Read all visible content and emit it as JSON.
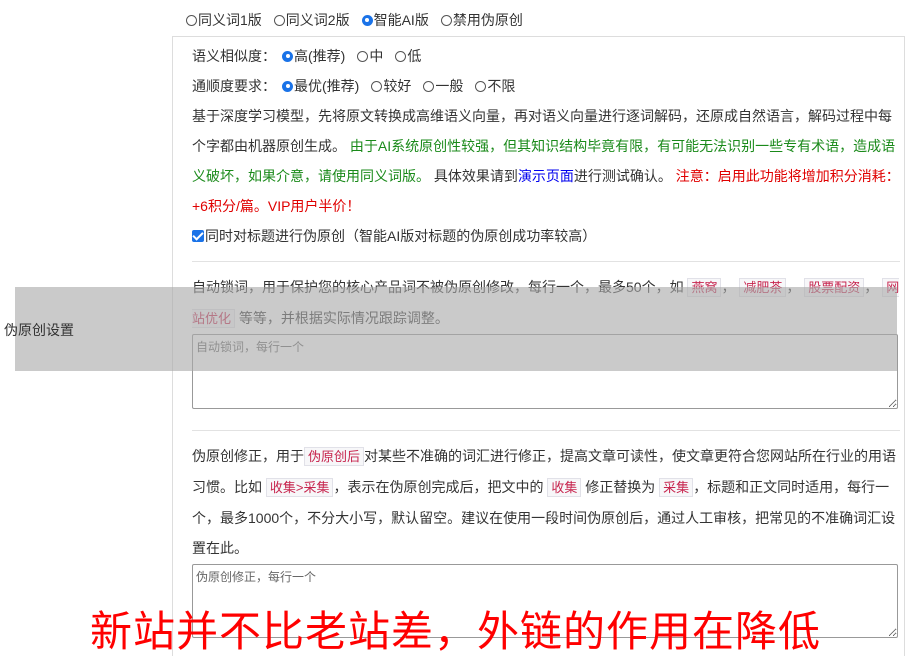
{
  "mode_options": [
    {
      "label": "同义词1版",
      "selected": false
    },
    {
      "label": "同义词2版",
      "selected": false
    },
    {
      "label": "智能AI版",
      "selected": true
    },
    {
      "label": "禁用伪原创",
      "selected": false
    }
  ],
  "similarity": {
    "label": "语义相似度：",
    "options": [
      {
        "label": "高(推荐)",
        "selected": true
      },
      {
        "label": "中",
        "selected": false
      },
      {
        "label": "低",
        "selected": false
      }
    ]
  },
  "fluency": {
    "label": "通顺度要求：",
    "options": [
      {
        "label": "最优(推荐)",
        "selected": true
      },
      {
        "label": "较好",
        "selected": false
      },
      {
        "label": "一般",
        "selected": false
      },
      {
        "label": "不限",
        "selected": false
      }
    ]
  },
  "description": {
    "text1": "基于深度学习模型，先将原文转换成高维语义向量，再对语义向量进行逐词解码，还原成自然语言，解码过程中每个字都由机器原创生成。",
    "warning_green": "由于AI系统原创性较强，但其知识结构毕竟有限，有可能无法识别一些专有术语，造成语义破坏，如果介意，请使用同义词版。",
    "text2a": "具体效果请到",
    "demo_link": "演示页面",
    "text2b": "进行测试确认。",
    "notice_red": "注意：启用此功能将增加积分消耗：+6积分/篇。VIP用户半价！"
  },
  "title_checkbox": {
    "checked": true,
    "label": "同时对标题进行伪原创（智能AI版对标题的伪原创成功率较高）"
  },
  "section_label": "伪原创设置",
  "lock_words": {
    "desc_a": "自动锁词，用于保护您的核心产品词不被伪原创修改，每行一个，最多50个，如",
    "examples": [
      "燕窝",
      "减肥茶",
      "股票配资",
      "网站优化"
    ],
    "desc_b": "等等，并根据实际情况跟踪调整。",
    "placeholder": "自动锁词，每行一个"
  },
  "correction": {
    "desc_a": "伪原创修正，用于",
    "tag1": "伪原创后",
    "desc_b": "对某些不准确的词汇进行修正，提高文章可读性，使文章更符合您网站所在行业的用语习惯。比如",
    "tag2": "收集>采集",
    "desc_c": "，表示在伪原创完成后，把文中的",
    "tag3": "收集",
    "desc_d": "修正替换为",
    "tag4": "采集",
    "desc_e": "，标题和正文同时适用，每行一个，最多1000个，不分大小写，默认留空。建议在使用一段时间伪原创后，通过人工审核，把常见的不准确词汇设置在此。",
    "placeholder": "伪原创修正，每行一个"
  },
  "watermark": "新站并不比老站差，外链的作用在降低"
}
